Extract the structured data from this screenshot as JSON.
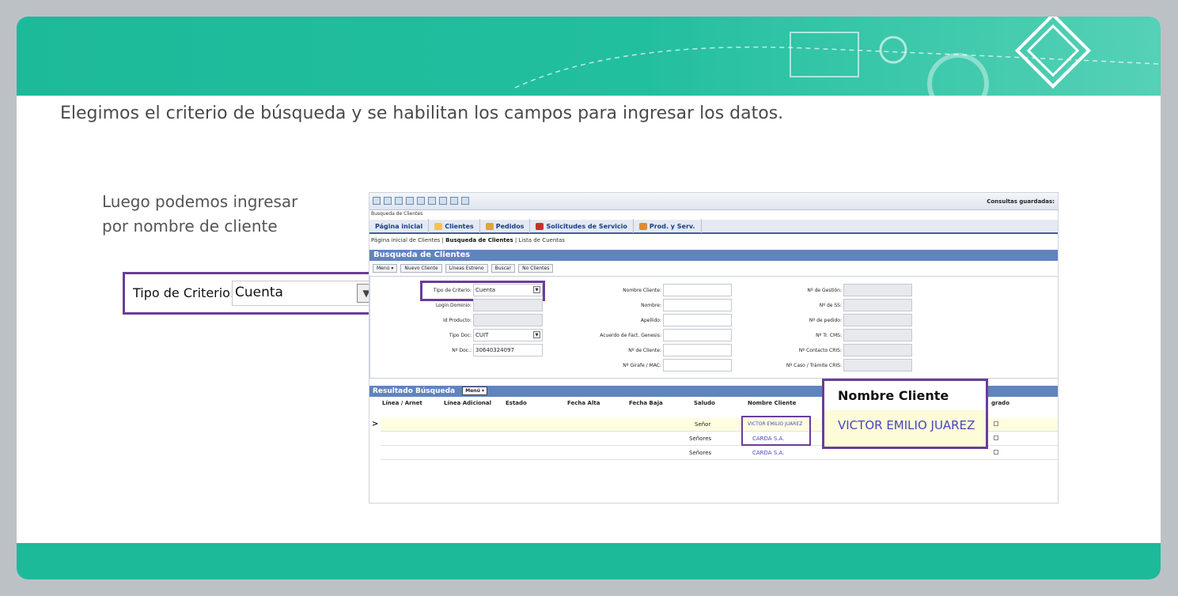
{
  "slide": {
    "headline": "Elegimos el criterio de búsqueda y se habilitan los campos para ingresar los datos.",
    "side_note_line1": "Luego podemos ingresar",
    "side_note_line2": "por nombre de cliente"
  },
  "zoom_tipo": {
    "label": "Tipo de Criterio:",
    "value": "Cuenta"
  },
  "zoom_nombre": {
    "header": "Nombre Cliente",
    "value": "VICTOR EMILIO JUAREZ"
  },
  "app": {
    "saved_queries": "Consultas guardadas:",
    "crumb_top": "Busqueda de Clientes",
    "tabs": [
      "Página inicial",
      "Clientes",
      "Pedidos",
      "Solicitudes de Servicio",
      "Prod. y Serv."
    ],
    "breadcrumb": {
      "a": "Página inicial de Clientes",
      "b": "Busqueda de Clientes",
      "c": "Lista de Cuentas"
    },
    "panel_title": "Busqueda de Clientes",
    "toolbar": [
      "Menú ▾",
      "Nuevo Cliente",
      "Líneas Estreno",
      "Buscar",
      "No Clientes"
    ],
    "form": {
      "tipo_label": "Tipo de Criterio:",
      "tipo_value": "Cuenta",
      "login_label": "Login Dominio:",
      "id_label": "Id Producto:",
      "tipodoc_label": "Tipo Doc:",
      "tipodoc_value": "CUIT",
      "nrodoc_label": "Nº Doc.:",
      "nrodoc_value": "30640324097",
      "nombre_cliente_label": "Nombre Cliente:",
      "nombre_label": "Nombre:",
      "apellido_label": "Apellido:",
      "acuerdo_label": "Acuerdo de Fact. Genesis:",
      "nro_cliente_label": "Nº de Cliente:",
      "girafe_label": "Nº Girafe / MAC:",
      "gestion_label": "Nº de Gestión:",
      "ss_label": "Nº de SS:",
      "pedido_label": "Nº de pedido:",
      "cms_label": "Nº Tr. CMS:",
      "contacto_label": "Nº Contacto CRIS:",
      "caso_label": "Nº Caso / Trámite CRIS:"
    },
    "results_title": "Resultado Búsqueda",
    "results_menu": "Menú ▾",
    "columns": [
      "Línea / Arnet",
      "Línea Adicional",
      "Estado",
      "Fecha Alta",
      "Fecha Baja",
      "Saludo",
      "Nombre Cliente",
      "grado"
    ],
    "rows": [
      {
        "saludo": "Señor",
        "nombre": "VICTOR EMILIO JUAREZ"
      },
      {
        "saludo": "Señores",
        "nombre": "CARDA S.A."
      },
      {
        "saludo": "Señores",
        "nombre": "CARDA S.A."
      }
    ]
  }
}
